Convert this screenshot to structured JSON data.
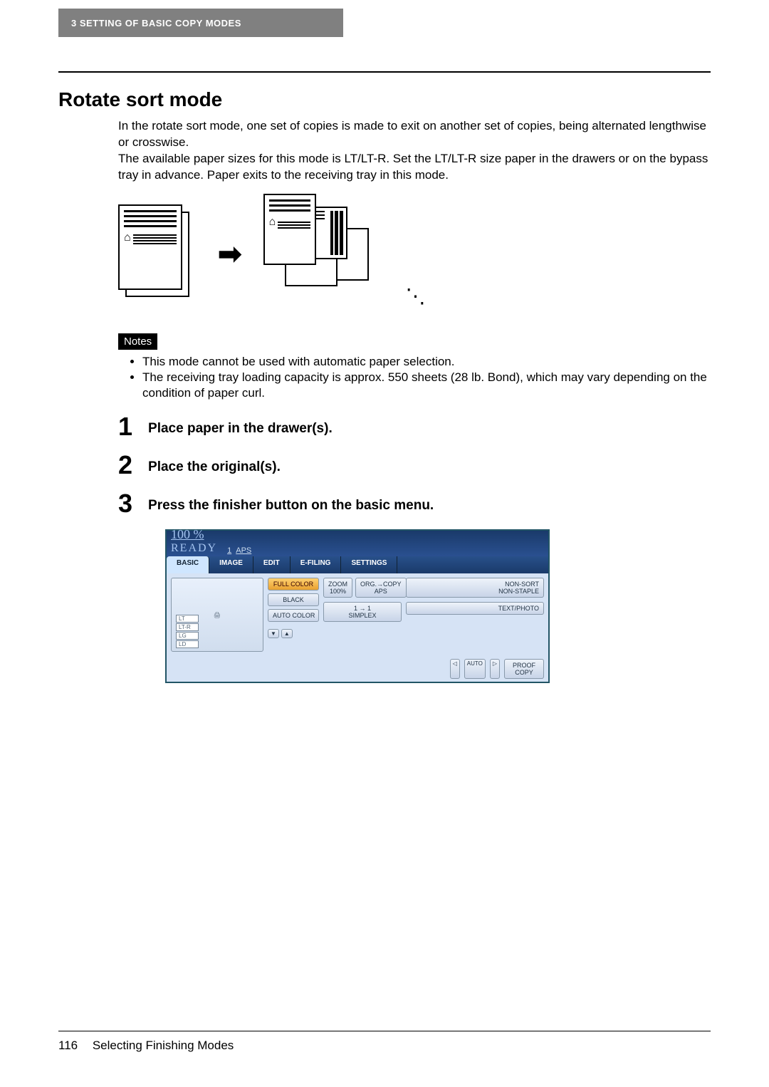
{
  "header": {
    "chapter": "3  SETTING OF BASIC COPY MODES"
  },
  "section": {
    "title": "Rotate sort mode"
  },
  "intro": {
    "p1": "In the rotate sort mode, one set of copies is made to exit on another set of copies, being alternated lengthwise or crosswise.",
    "p2": "The available paper sizes for this mode is LT/LT-R. Set the LT/LT-R size paper in the drawers or on the bypass tray in advance. Paper exits to the receiving tray in this mode."
  },
  "notes": {
    "label": "Notes",
    "items": [
      "This mode cannot be used with automatic paper selection.",
      "The receiving tray loading capacity is approx. 550 sheets (28 lb. Bond), which may vary depending on the condition of paper curl."
    ]
  },
  "steps": [
    {
      "num": "1",
      "text": "Place paper in the drawer(s)."
    },
    {
      "num": "2",
      "text": "Place the original(s)."
    },
    {
      "num": "3",
      "text": "Press the finisher button on the basic menu."
    }
  ],
  "panel": {
    "percent": "100  %",
    "one": "1",
    "aps": "APS",
    "ready": "READY",
    "tabs": [
      "BASIC",
      "IMAGE",
      "EDIT",
      "E-FILING",
      "SETTINGS"
    ],
    "color_btns": [
      "FULL COLOR",
      "BLACK",
      "AUTO COLOR"
    ],
    "zoom": "ZOOM\n100%",
    "org": "ORG.→COPY\nAPS",
    "simplex": "1 → 1\nSIMPLEX",
    "nonsort": "NON-SORT\nNON-STAPLE",
    "textphoto": "TEXT/PHOTO",
    "proof": "PROOF\nCOPY",
    "auto": "AUTO",
    "drawers": [
      "LT",
      "LT-R",
      "LG",
      "LD"
    ]
  },
  "footer": {
    "page": "116",
    "title": "Selecting Finishing Modes"
  }
}
